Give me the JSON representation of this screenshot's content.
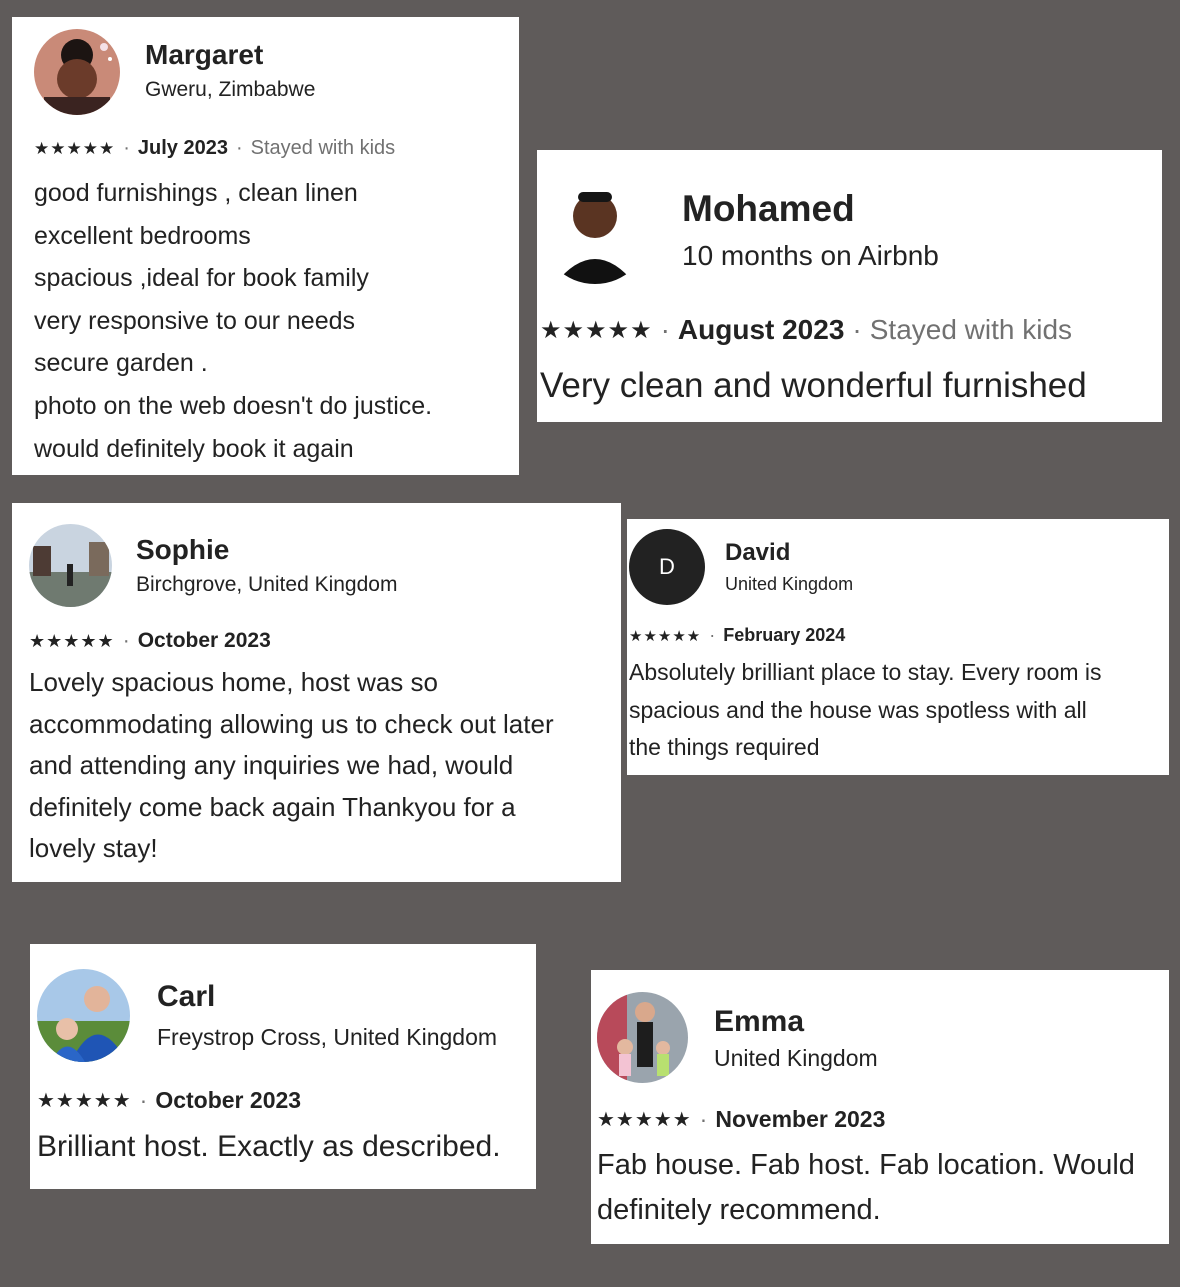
{
  "reviews": [
    {
      "name": "Margaret",
      "subtitle": "Gweru, Zimbabwe",
      "stars": "★★★★★",
      "date": "July 2023",
      "extra": "Stayed with kids",
      "lines": [
        "good furnishings , clean linen",
        "excellent bedrooms",
        "spacious ,ideal for book family",
        "very responsive to our needs",
        "secure garden .",
        "photo on the web doesn't do justice.",
        "would definitely book it again"
      ]
    },
    {
      "name": "Mohamed",
      "subtitle": "10 months on Airbnb",
      "stars": "★★★★★",
      "date": "August 2023",
      "extra": "Stayed with kids",
      "lines": [
        "Very clean and wonderful furnished"
      ]
    },
    {
      "name": "Sophie",
      "subtitle": "Birchgrove, United Kingdom",
      "stars": "★★★★★",
      "date": "October 2023",
      "lines": [
        "Lovely spacious home, host was so",
        "accommodating allowing us to check out later",
        "and attending any inquiries we had, would",
        "definitely come back again Thankyou for a",
        "lovely stay!"
      ]
    },
    {
      "name": "David",
      "initial": "D",
      "subtitle": "United Kingdom",
      "stars": "★★★★★",
      "date": "February 2024",
      "lines": [
        "Absolutely brilliant place to stay. Every room is",
        "spacious and the house was spotless with all",
        "the things required"
      ]
    },
    {
      "name": "Carl",
      "subtitle": "Freystrop Cross, United Kingdom",
      "stars": "★★★★★",
      "date": "October 2023",
      "lines": [
        "Brilliant host. Exactly as described."
      ]
    },
    {
      "name": "Emma",
      "subtitle": "United Kingdom",
      "stars": "★★★★★",
      "date": "November 2023",
      "lines": [
        "Fab house. Fab host. Fab location. Would",
        "definitely recommend."
      ]
    }
  ],
  "separator": "·",
  "colors": {
    "background": "#5f5b5a",
    "card": "#ffffff",
    "text": "#222222",
    "muted": "#717171"
  }
}
